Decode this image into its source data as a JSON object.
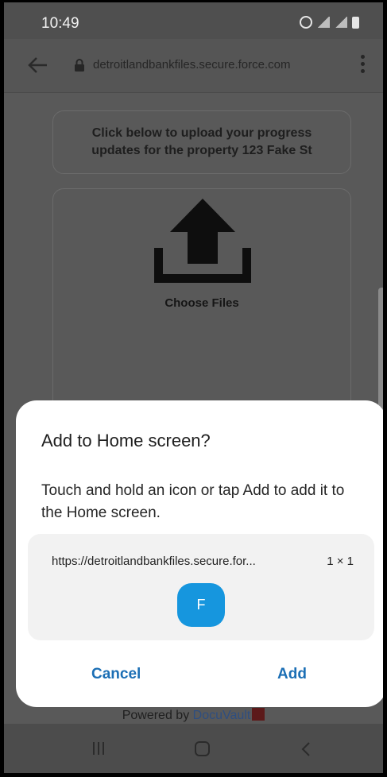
{
  "status_bar": {
    "time": "10:49"
  },
  "browser": {
    "url": "detroitlandbankfiles.secure.force.com"
  },
  "page": {
    "info_text_line1": "Click below to upload your progress",
    "info_text_line2": "updates for the property 123 Fake St",
    "choose_files_label": "Choose Files",
    "powered_by_prefix": "Powered by ",
    "powered_by_brand": "DocuVault"
  },
  "dialog": {
    "title": "Add to Home screen?",
    "message": "Touch and hold an icon or tap Add to add it to the Home screen.",
    "shortcut_url": "https://detroitlandbankfiles.secure.for...",
    "shortcut_size": "1 × 1",
    "shortcut_icon_letter": "F",
    "cancel_label": "Cancel",
    "add_label": "Add"
  },
  "colors": {
    "accent": "#1c6fb5",
    "shortcut_icon": "#1696de",
    "dim_overlay": "#595959"
  },
  "icons": {
    "back": "arrow-left-icon",
    "lock": "lock-icon",
    "menu": "more-vert-icon",
    "upload": "upload-icon",
    "nav_recents": "recents-icon",
    "nav_home": "home-icon",
    "nav_back": "chevron-left-icon"
  }
}
